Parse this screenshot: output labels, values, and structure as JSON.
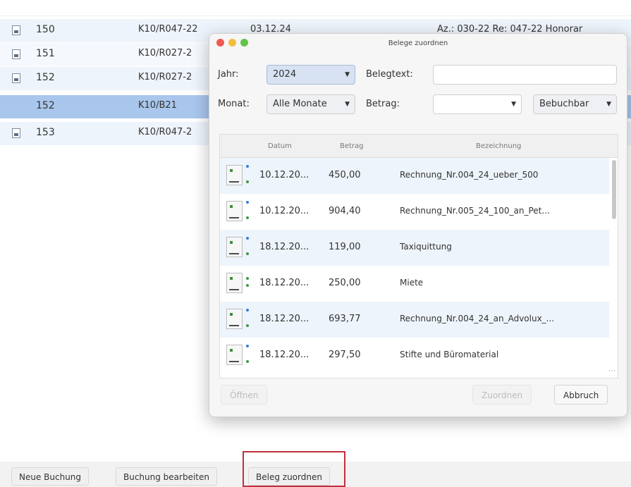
{
  "background_table": {
    "rows": [
      {
        "num": "150",
        "konto": "K10/R047-22",
        "datum": "03.12.24",
        "text": "Az.: 030-22 Re: 047-22 Honorar",
        "style": "alt",
        "icon": "doc-icon"
      },
      {
        "num": "151",
        "konto": "K10/R027-2",
        "datum": "",
        "text": "",
        "style": "plain",
        "icon": "doc-icon"
      },
      {
        "num": "152",
        "konto": "K10/R027-2",
        "datum": "",
        "text": "",
        "style": "alt",
        "icon": "doc-icon"
      },
      {
        "num": "152",
        "konto": "K10/B21",
        "datum": "",
        "text": "",
        "style": "sel",
        "icon": ""
      },
      {
        "num": "153",
        "konto": "K10/R047-2",
        "datum": "",
        "text": "",
        "style": "alt",
        "icon": "doc-icon"
      }
    ]
  },
  "buttons": {
    "neue_buchung": "Neue Buchung",
    "buchung_bearbeiten": "Buchung bearbeiten",
    "beleg_zuordnen": "Beleg zuordnen"
  },
  "dialog": {
    "title": "Belege zuordnen",
    "jahr_label": "Jahr:",
    "jahr_value": "2024",
    "belegtext_label": "Belegtext:",
    "belegtext_value": "",
    "monat_label": "Monat:",
    "monat_value": "Alle Monate",
    "betrag_label": "Betrag:",
    "betrag_value": "",
    "filter_value": "Bebuchbar",
    "columns": [
      "Datum",
      "Betrag",
      "Bezeichnung"
    ],
    "rows": [
      {
        "datum": "10.12.20...",
        "betrag": "450,00",
        "bezeichnung": "Rechnung_Nr.004_24_ueber_500"
      },
      {
        "datum": "10.12.20...",
        "betrag": "904,40",
        "bezeichnung": "Rechnung_Nr.005_24_100_an_Pet..."
      },
      {
        "datum": "18.12.20...",
        "betrag": "119,00",
        "bezeichnung": "Taxiquittung"
      },
      {
        "datum": "18.12.20...",
        "betrag": "250,00",
        "bezeichnung": "Miete"
      },
      {
        "datum": "18.12.20...",
        "betrag": "693,77",
        "bezeichnung": "Rechnung_Nr.004_24_an_Advolux_..."
      },
      {
        "datum": "18.12.20...",
        "betrag": "297,50",
        "bezeichnung": "Stifte und Büromaterial"
      }
    ],
    "oeffnen_label": "Öffnen",
    "zuordnen_label": "Zuordnen",
    "abbruch_label": "Abbruch"
  },
  "colors": {
    "selection": "#a9c6ec",
    "row_alt": "#eef4fb",
    "highlight_border": "#c0303c",
    "traffic_red": "#ee5b52",
    "traffic_yellow": "#f4bd3a",
    "traffic_green": "#5fc448"
  }
}
